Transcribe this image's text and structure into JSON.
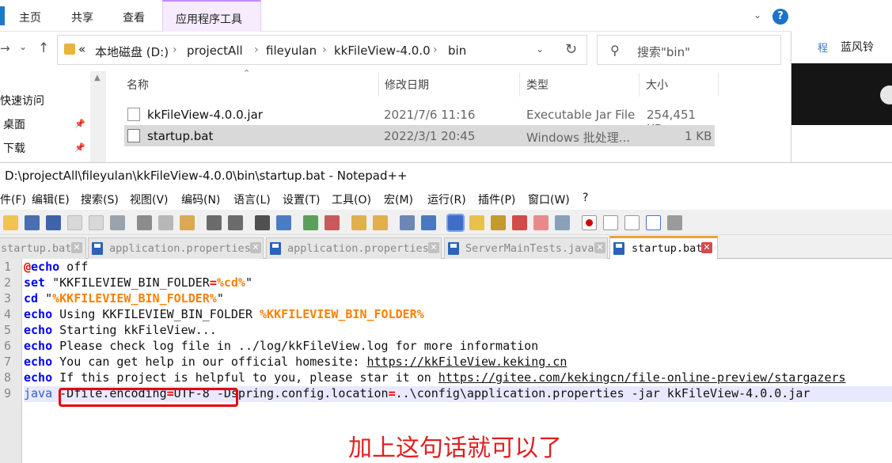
{
  "explorer": {
    "ribbon_tabs": [
      "主页",
      "共享",
      "查看"
    ],
    "ribbon_app_tab": "应用程序工具",
    "help": "?",
    "address": {
      "root": "«",
      "crumbs": [
        "本地磁盘 (D:)",
        "projectAll",
        "fileyulan",
        "kkFileView-4.0.0",
        "bin"
      ]
    },
    "search_placeholder": "搜索\"bin\"",
    "nav": {
      "items": [
        "快速访问",
        "桌面",
        "下载"
      ]
    },
    "columns": [
      "名称",
      "修改日期",
      "类型",
      "大小"
    ],
    "files": [
      {
        "name": "kkFileView-4.0.0.jar",
        "date": "2021/7/6 11:16",
        "type": "Executable Jar File",
        "size": "254,451 KB",
        "selected": false
      },
      {
        "name": "startup.bat",
        "date": "2022/3/1 20:45",
        "type": "Windows 批处理...",
        "size": "1 KB",
        "selected": true
      }
    ]
  },
  "side_panel": {
    "tag": "程",
    "name": "蓝风铃"
  },
  "notepad": {
    "title": "D:\\projectAll\\fileyulan\\kkFileView-4.0.0\\bin\\startup.bat - Notepad++",
    "menu": [
      "件(F)",
      "编辑(E)",
      "搜索(S)",
      "视图(V)",
      "编码(N)",
      "语言(L)",
      "设置(T)",
      "工具(O)",
      "宏(M)",
      "运行(R)",
      "插件(P)",
      "窗口(W)",
      "?"
    ],
    "tabs": [
      {
        "label": "startup.bat",
        "active": false
      },
      {
        "label": "application.properties",
        "active": false
      },
      {
        "label": "application.properties",
        "active": false
      },
      {
        "label": "ServerMainTests.java",
        "active": false
      },
      {
        "label": "startup.bat",
        "active": true
      }
    ],
    "line_numbers": [
      "1",
      "2",
      "3",
      "4",
      "5",
      "6",
      "7",
      "8",
      "9"
    ],
    "code": {
      "l1a": "@",
      "l1b": "echo",
      "l1c": " off",
      "l2a": "set",
      "l2b": " \"KKFILEVIEW_BIN_FOLDER",
      "l2c": "=",
      "l2d": "%cd%",
      "l2e": "\"",
      "l3a": "cd",
      "l3b": " \"",
      "l3c": "%KKFILEVIEW_BIN_FOLDER%",
      "l3d": "\"",
      "l4a": "echo",
      "l4b": " Using KKFILEVIEW_BIN_FOLDER ",
      "l4c": "%KKFILEVIEW_BIN_FOLDER%",
      "l5a": "echo",
      "l5b": " Starting kkFileView...",
      "l6a": "echo",
      "l6b": " Please check log file in ../log/kkFileView.log for more information",
      "l7a": "echo",
      "l7b": " You can get help in our official homesite: ",
      "l7c": "https://kkFileView.keking.cn",
      "l8a": "echo",
      "l8b": " If this project is helpful to you, please star it on ",
      "l8c": "https://gitee.com/kekingcn/file-online-preview/stargazers",
      "l9a": "java",
      "l9b": " -Dfile.encoding",
      "l9c": "=",
      "l9d": "UTF-8 -Dspring.config.location",
      "l9e": "=",
      "l9f": "..\\config\\application.properties -jar kkFileView-4.0.0.jar"
    }
  },
  "annotation": "加上这句话就可以了",
  "colors": {
    "accent_red": "#e60000",
    "keyword_blue": "#0000ff",
    "var_orange": "#ff8000"
  }
}
